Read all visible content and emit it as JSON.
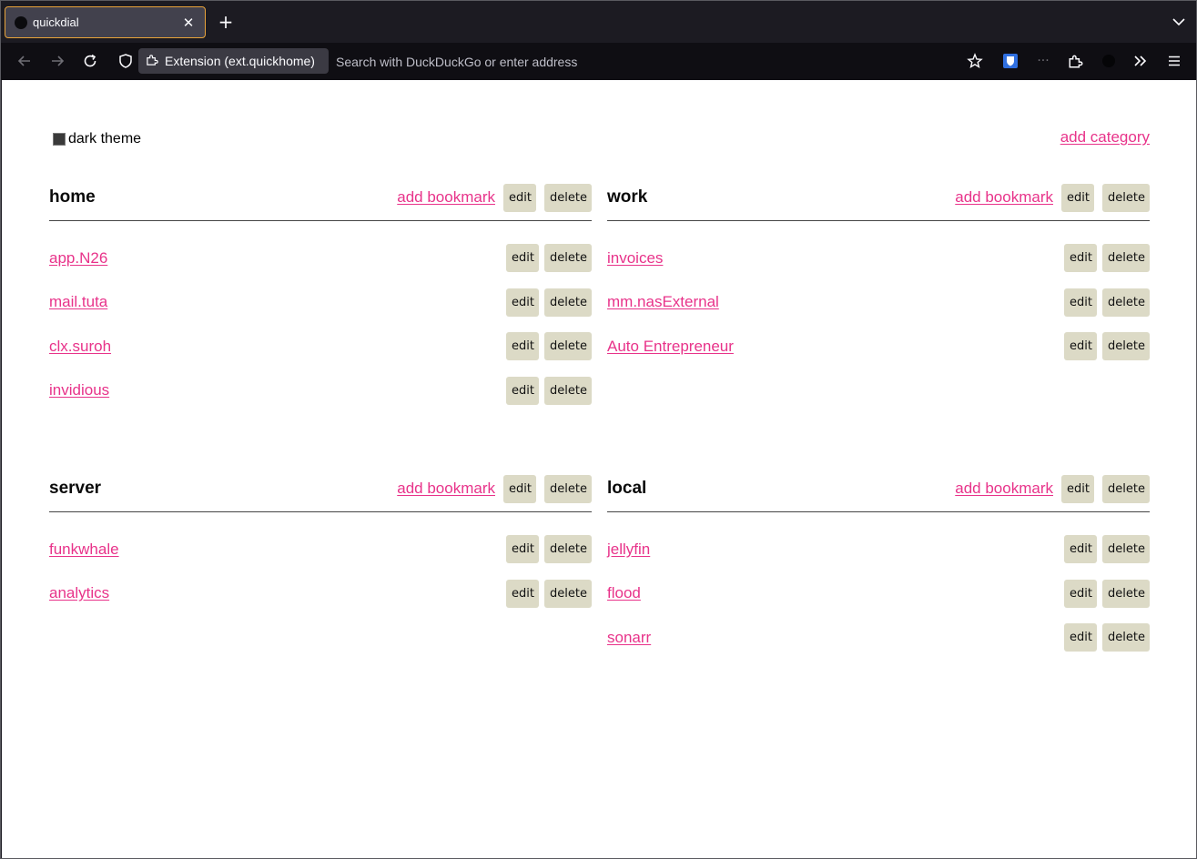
{
  "browser": {
    "tab_title": "quickdial",
    "tab_close": "✕",
    "new_tab": "+",
    "url_identity": "Extension (ext.quickhome)",
    "url_placeholder": "Search with DuckDuckGo or enter address",
    "overflow_dots": "···"
  },
  "page": {
    "theme_label": "dark theme",
    "add_category_label": "add category",
    "add_bookmark_label": "add bookmark",
    "edit_label": "edit",
    "delete_label": "delete",
    "categories": [
      {
        "name": "home",
        "bookmarks": [
          "app.N26",
          "mail.tuta",
          "clx.suroh",
          "invidious"
        ]
      },
      {
        "name": "work",
        "bookmarks": [
          "invoices",
          "mm.nasExternal",
          "Auto Entrepreneur"
        ]
      },
      {
        "name": "server",
        "bookmarks": [
          "funkwhale",
          "analytics"
        ]
      },
      {
        "name": "local",
        "bookmarks": [
          "jellyfin",
          "flood",
          "sonarr"
        ]
      }
    ]
  },
  "colors": {
    "link": "#e8338a",
    "button_bg": "#dcdac6",
    "tab_border": "#e8a33a",
    "toolbar_bg": "#0f0e13"
  }
}
